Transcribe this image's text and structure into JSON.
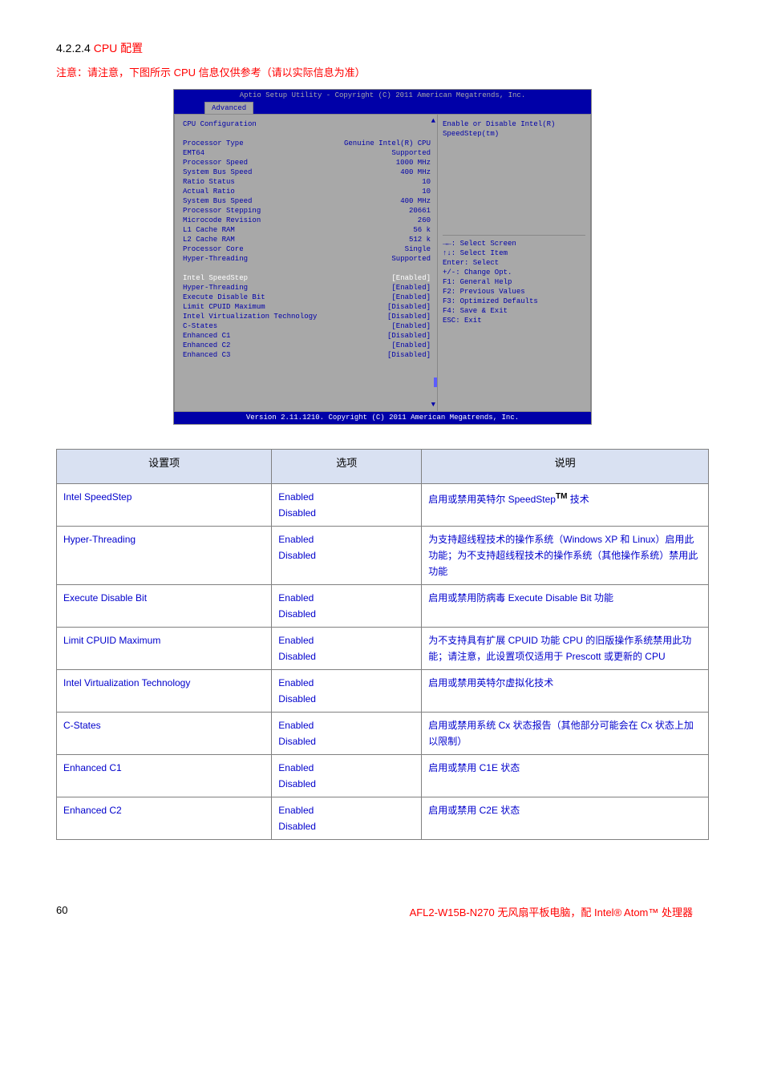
{
  "heading": {
    "num": "4.2.2.4",
    "title": "CPU 配置"
  },
  "note": "注意：请注意，下图所示 CPU 信息仅供参考（请以实际信息为准）",
  "bios": {
    "topbar": "Aptio Setup Utility - Copyright (C) 2011 American Megatrends, Inc.",
    "tab": "Advanced",
    "section_title": "CPU Configuration",
    "info_rows": [
      {
        "label": "Processor Type",
        "value": "Genuine Intel(R) CPU"
      },
      {
        "label": "EMT64",
        "value": "Supported"
      },
      {
        "label": "Processor Speed",
        "value": "1000 MHz"
      },
      {
        "label": "System Bus Speed",
        "value": "400 MHz"
      },
      {
        "label": "Ratio Status",
        "value": "10"
      },
      {
        "label": "Actual Ratio",
        "value": "10"
      },
      {
        "label": "System Bus Speed",
        "value": "400 MHz"
      },
      {
        "label": "Processor Stepping",
        "value": "20661"
      },
      {
        "label": "Microcode Revision",
        "value": "260"
      },
      {
        "label": "L1 Cache RAM",
        "value": "56 k"
      },
      {
        "label": "L2 Cache RAM",
        "value": "512 k"
      },
      {
        "label": "Processor Core",
        "value": "Single"
      },
      {
        "label": "Hyper-Threading",
        "value": "Supported"
      }
    ],
    "option_rows": [
      {
        "label": "Intel SpeedStep",
        "value": "[Enabled]",
        "selected": true
      },
      {
        "label": "Hyper-Threading",
        "value": "[Enabled]",
        "selected": false
      },
      {
        "label": "Execute Disable Bit",
        "value": "[Enabled]",
        "selected": false
      },
      {
        "label": "Limit CPUID Maximum",
        "value": "[Disabled]",
        "selected": false
      },
      {
        "label": "Intel Virtualization Technology",
        "value": "[Disabled]",
        "selected": false
      },
      {
        "label": "C-States",
        "value": "[Enabled]",
        "selected": false
      },
      {
        "label": "Enhanced C1",
        "value": "[Disabled]",
        "selected": false
      },
      {
        "label": "Enhanced C2",
        "value": "[Enabled]",
        "selected": false
      },
      {
        "label": "Enhanced C3",
        "value": "[Disabled]",
        "selected": false
      }
    ],
    "help_top": "Enable or Disable Intel(R) SpeedStep(tm)",
    "help_keys": [
      "→←: Select Screen",
      "↑↓: Select Item",
      "Enter: Select",
      "+/-: Change Opt.",
      "F1: General Help",
      "F2: Previous Values",
      "F3: Optimized Defaults",
      "F4: Save & Exit",
      "ESC: Exit"
    ],
    "bottombar": "Version 2.11.1210. Copyright (C) 2011 American Megatrends, Inc."
  },
  "table": {
    "headers": [
      "设置项",
      "选项",
      "说明"
    ],
    "rows": [
      {
        "name": "Intel SpeedStep",
        "options": "Enabled\nDisabled",
        "desc_prefix": "启用或禁用英特尔 SpeedStep",
        "desc_tm": "TM",
        "desc_suffix": " 技术"
      },
      {
        "name": "Hyper-Threading",
        "options": "Enabled\nDisabled",
        "desc": "为支持超线程技术的操作系统（Windows XP 和 Linux）启用此功能；为不支持超线程技术的操作系统（其他操作系统）禁用此功能"
      },
      {
        "name": "Execute Disable Bit",
        "options": "Enabled\nDisabled",
        "desc": "启用或禁用防病毒 Execute Disable Bit 功能"
      },
      {
        "name": "Limit CPUID Maximum",
        "options": "Enabled\nDisabled",
        "desc": "为不支持具有扩展 CPUID 功能 CPU 的旧版操作系统禁用此功能；请注意，此设置项仅适用于 Prescott 或更新的 CPU"
      },
      {
        "name": "Intel Virtualization Technology",
        "options": "Enabled\nDisabled",
        "desc": "启用或禁用英特尔虚拟化技术"
      },
      {
        "name": "C-States",
        "options": "Enabled\nDisabled",
        "desc": "启用或禁用系统 Cx 状态报告（其他部分可能会在 Cx 状态上加以限制）"
      },
      {
        "name": "Enhanced C1",
        "options": "Enabled\nDisabled",
        "desc": "启用或禁用 C1E 状态"
      },
      {
        "name": "Enhanced C2",
        "options": "Enabled\nDisabled",
        "desc": "启用或禁用 C2E 状态"
      }
    ]
  },
  "footer": {
    "left": "60",
    "right": "AFL2-W15B-N270 无风扇平板电脑，配 Intel® Atom™ 处理器"
  }
}
